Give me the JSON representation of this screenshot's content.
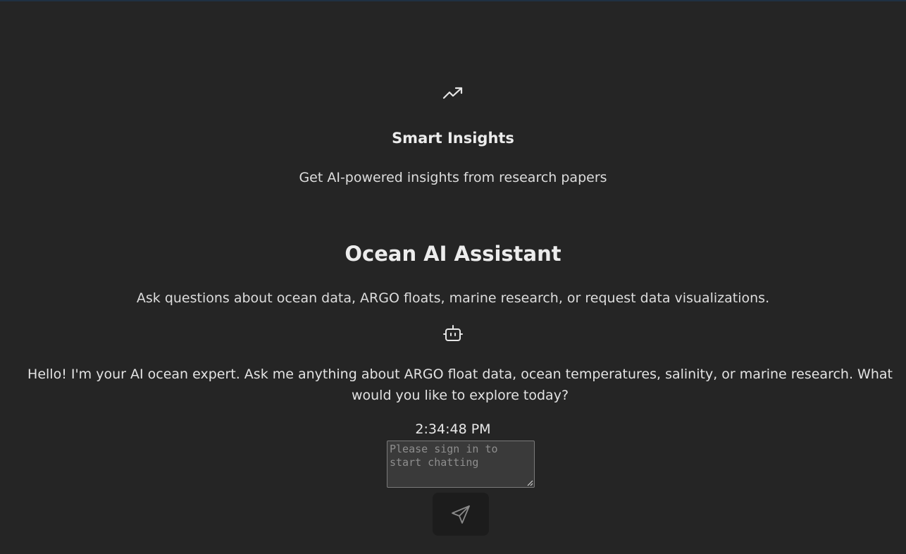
{
  "feature": {
    "icon": "trending-up-icon",
    "title": "Smart Insights",
    "description": "Get AI-powered insights from research papers"
  },
  "assistant": {
    "title": "Ocean AI Assistant",
    "description": "Ask questions about ocean data, ARGO floats, marine research, or request data visualizations."
  },
  "message": {
    "icon": "bot-icon",
    "text": "Hello! I'm your AI ocean expert. Ask me anything about ARGO float data, ocean temperatures, salinity, or marine research. What would you like to explore today?",
    "timestamp": "2:34:48 PM"
  },
  "composer": {
    "placeholder": "Please sign in to start chatting",
    "value": "",
    "send_icon": "send-icon"
  },
  "colors": {
    "background": "#252525",
    "text": "#e6e6e6",
    "input_bg": "#3a3a3a",
    "button_bg": "#1c1c1c"
  }
}
